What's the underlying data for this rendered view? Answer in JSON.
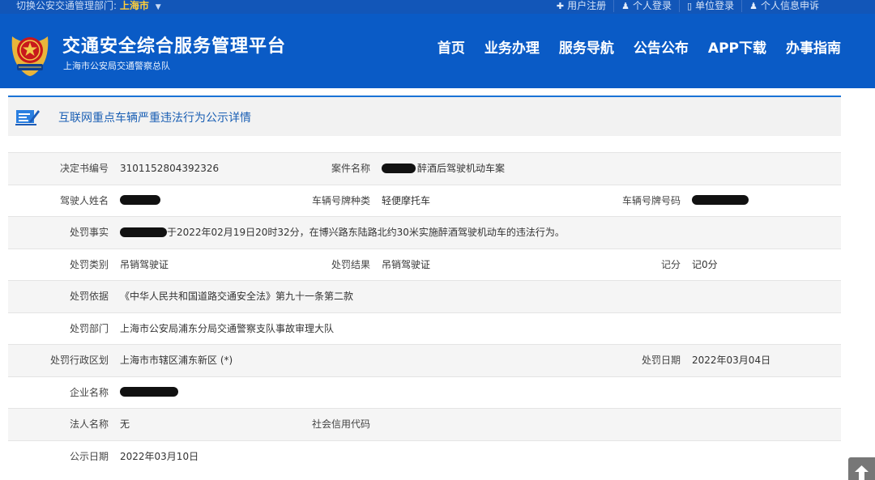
{
  "topbar": {
    "switch_label": "切换公安交通管理部门:",
    "city": "上海市",
    "links": [
      {
        "icon": "plus-icon",
        "glyph": "✚",
        "label": "用户注册"
      },
      {
        "icon": "user-icon",
        "glyph": "♟",
        "label": "个人登录"
      },
      {
        "icon": "building-icon",
        "glyph": "▯",
        "label": "单位登录"
      },
      {
        "icon": "user-icon",
        "glyph": "♟",
        "label": "个人信息申诉"
      }
    ]
  },
  "header": {
    "title": "交通安全综合服务管理平台",
    "subtitle": "上海市公安局交通警察总队",
    "nav": [
      "首页",
      "业务办理",
      "服务导航",
      "公告公布",
      "APP下载",
      "办事指南"
    ]
  },
  "section": {
    "title": "互联网重点车辆严重违法行为公示详情"
  },
  "detail": {
    "decision_no_label": "决定书编号",
    "decision_no": "3101152804392326",
    "case_name_label": "案件名称",
    "case_name": "醉酒后驾驶机动车案",
    "driver_name_label": "驾驶人姓名",
    "plate_type_label": "车辆号牌种类",
    "plate_type": "轻便摩托车",
    "plate_no_label": "车辆号牌号码",
    "facts_label": "处罚事实",
    "facts": "于2022年02月19日20时32分，在博兴路东陆路北约30米实施醉酒驾驶机动车的违法行为。",
    "penalty_type_label": "处罚类别",
    "penalty_type": "吊销驾驶证",
    "penalty_result_label": "处罚结果",
    "penalty_result": "吊销驾驶证",
    "points_label": "记分",
    "points": "记0分",
    "basis_label": "处罚依据",
    "basis": "《中华人民共和国道路交通安全法》第九十一条第二款",
    "dept_label": "处罚部门",
    "dept": "上海市公安局浦东分局交通警察支队事故审理大队",
    "district_label": "处罚行政区划",
    "district": "上海市市辖区浦东新区 (*)",
    "penalty_date_label": "处罚日期",
    "penalty_date": "2022年03月04日",
    "company_label": "企业名称",
    "legal_rep_label": "法人名称",
    "legal_rep": "无",
    "credit_code_label": "社会信用代码",
    "publish_date_label": "公示日期",
    "publish_date": "2022年03月10日"
  },
  "colors": {
    "header_blue": "#0a5bc6",
    "accent_gold": "#ffcf3a",
    "section_title": "#1a5fb4"
  }
}
